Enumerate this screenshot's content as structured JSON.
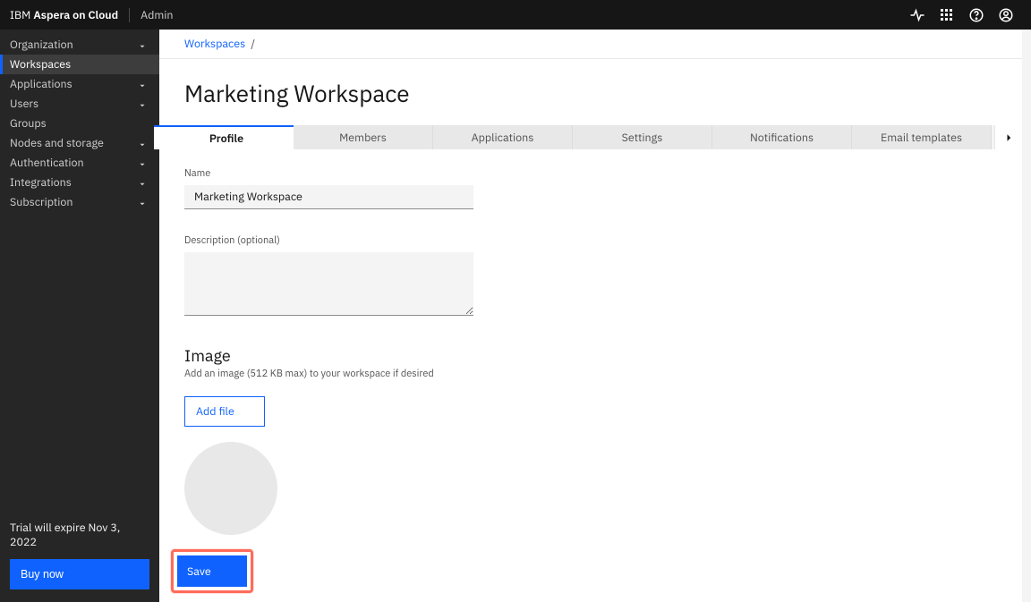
{
  "header": {
    "brand_prefix": "IBM",
    "brand_product": "Aspera on Cloud",
    "admin_label": "Admin"
  },
  "sidebar": {
    "items": [
      {
        "label": "Organization",
        "expandable": true,
        "active": false
      },
      {
        "label": "Workspaces",
        "expandable": false,
        "active": true
      },
      {
        "label": "Applications",
        "expandable": true,
        "active": false
      },
      {
        "label": "Users",
        "expandable": true,
        "active": false
      },
      {
        "label": "Groups",
        "expandable": false,
        "active": false
      },
      {
        "label": "Nodes and storage",
        "expandable": true,
        "active": false
      },
      {
        "label": "Authentication",
        "expandable": true,
        "active": false
      },
      {
        "label": "Integrations",
        "expandable": true,
        "active": false
      },
      {
        "label": "Subscription",
        "expandable": true,
        "active": false
      }
    ],
    "trial_text": "Trial will expire Nov 3, 2022",
    "buy_now_label": "Buy now"
  },
  "breadcrumb": {
    "root_label": "Workspaces",
    "separator": "/"
  },
  "page": {
    "title": "Marketing Workspace"
  },
  "tabs": {
    "items": [
      {
        "label": "Profile",
        "active": true
      },
      {
        "label": "Members",
        "active": false
      },
      {
        "label": "Applications",
        "active": false
      },
      {
        "label": "Settings",
        "active": false
      },
      {
        "label": "Notifications",
        "active": false
      },
      {
        "label": "Email templates",
        "active": false
      }
    ]
  },
  "profile": {
    "name_label": "Name",
    "name_value": "Marketing Workspace",
    "description_label": "Description (optional)",
    "description_value": "",
    "image_heading": "Image",
    "image_sub": "Add an image (512 KB max) to your workspace if desired",
    "add_file_label": "Add file"
  },
  "actions": {
    "save_label": "Save"
  }
}
